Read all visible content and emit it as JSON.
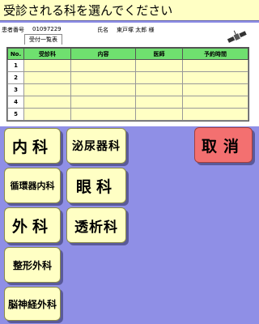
{
  "header": {
    "title": "受診される科を選んでください"
  },
  "patient": {
    "id_label": "患者番号",
    "id_value": "01097229",
    "name_label": "氏名",
    "name_value": "東戸塚 太郎 様"
  },
  "list_tab": "受付一覧表",
  "table": {
    "columns": [
      "No.",
      "受診科",
      "内容",
      "医師",
      "予約時間"
    ],
    "rows": [
      {
        "no": "1",
        "dept": "",
        "content": "",
        "doctor": "",
        "time": ""
      },
      {
        "no": "2",
        "dept": "",
        "content": "",
        "doctor": "",
        "time": ""
      },
      {
        "no": "3",
        "dept": "",
        "content": "",
        "doctor": "",
        "time": ""
      },
      {
        "no": "4",
        "dept": "",
        "content": "",
        "doctor": "",
        "time": ""
      },
      {
        "no": "5",
        "dept": "",
        "content": "",
        "doctor": "",
        "time": ""
      }
    ]
  },
  "departments": {
    "internal": "内科",
    "urology": "泌尿器科",
    "cardio": "循環器内科",
    "ophthalmology": "眼科",
    "surgery": "外科",
    "dialysis": "透析科",
    "orthopedics": "整形外科",
    "neurosurgery": "脳神経外科"
  },
  "cancel_label": "取消",
  "colors": {
    "background": "#8f8fe6",
    "button": "#ffffc4",
    "cancel": "#f37070",
    "table_header": "#6fe06f"
  },
  "icons": {
    "corner": "satellite-icon"
  }
}
